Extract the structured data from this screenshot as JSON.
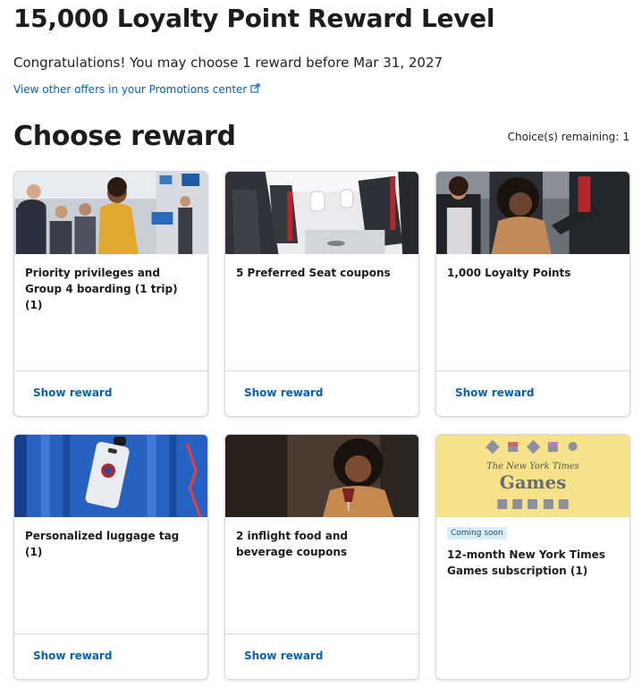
{
  "header": {
    "title": "15,000 Loyalty Point Reward Level",
    "congrats": "Congratulations! You may choose 1 reward before Mar 31, 2027",
    "promo_link": "View other offers in your Promotions center"
  },
  "section": {
    "title": "Choose reward",
    "choices_label": "Choice(s) remaining:",
    "choices_value": "1"
  },
  "cards": [
    {
      "title": "Priority privileges and Group 4 boarding (1 trip) (1)",
      "button": "Show reward",
      "image": "boarding-photo"
    },
    {
      "title": "5 Preferred Seat coupons",
      "button": "Show reward",
      "image": "cabin-seats-photo"
    },
    {
      "title": "1,000 Loyalty Points",
      "button": "Show reward",
      "image": "passenger-photo"
    },
    {
      "title": "Personalized luggage tag (1)",
      "button": "Show reward",
      "image": "luggage-tag-photo"
    },
    {
      "title": "2 inflight food and beverage coupons",
      "button": "Show reward",
      "image": "inflight-drink-photo"
    },
    {
      "title": "12-month New York Times Games subscription (1)",
      "button": "",
      "badge": "Coming soon",
      "image": "nyt-games-logo",
      "logo_top": "The New York Times",
      "logo_bottom": "Games"
    }
  ],
  "colors": {
    "link": "#0b5fb0",
    "border": "#d4d8de",
    "badge_bg": "#d8ecfb",
    "nyt_bg": "#f5e28a"
  }
}
